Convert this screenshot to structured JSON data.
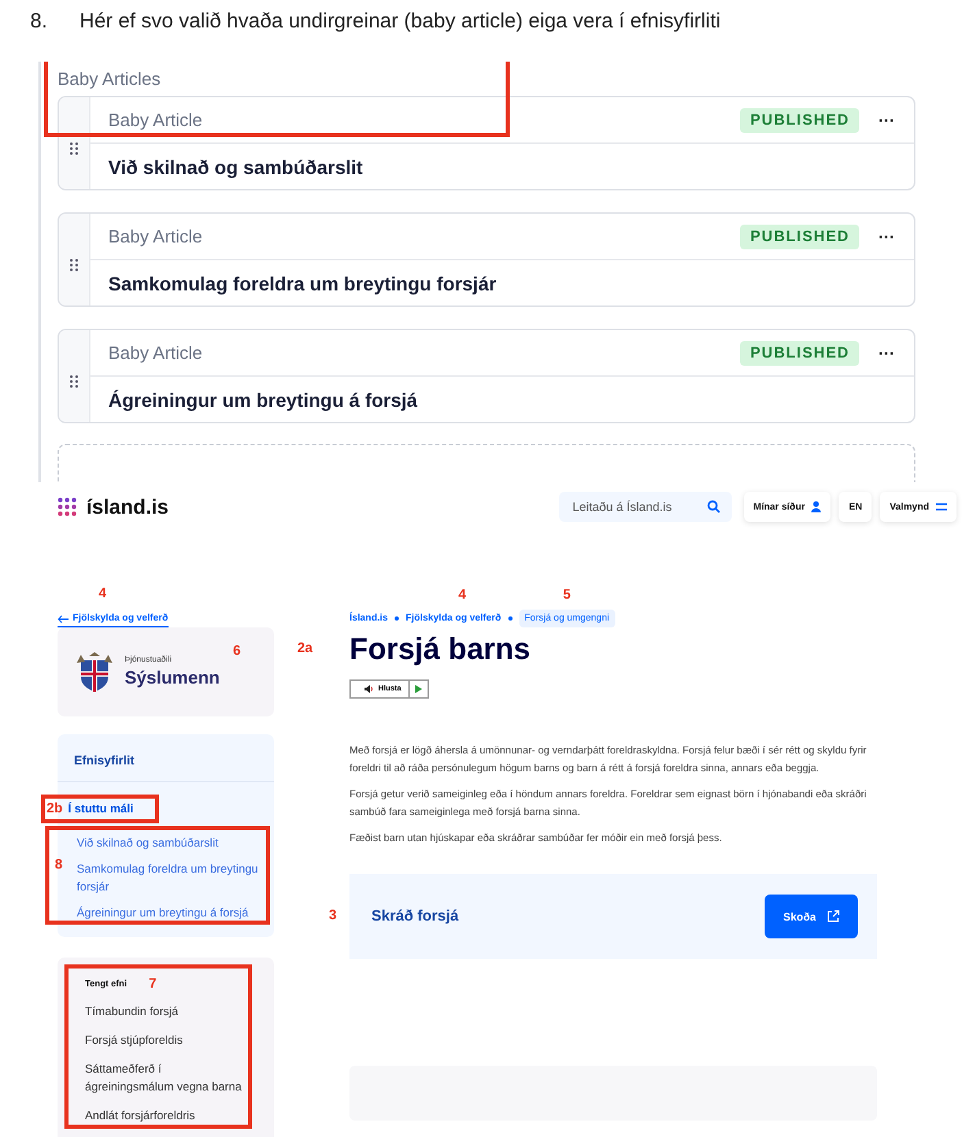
{
  "step": {
    "number": "8.",
    "text": "Hér ef svo valið hvaða undirgreinar (baby article) eiga vera í efnisyfirliti"
  },
  "cms": {
    "section_label": "Baby Articles",
    "annotation_box": true,
    "items": [
      {
        "type_label": "Baby Article",
        "status": "PUBLISHED",
        "menu": "···",
        "title": "Við skilnað og sambúðarslit"
      },
      {
        "type_label": "Baby Article",
        "status": "PUBLISHED",
        "menu": "···",
        "title": "Samkomulag foreldra um breytingu forsjár"
      },
      {
        "type_label": "Baby Article",
        "status": "PUBLISHED",
        "menu": "···",
        "title": "Ágreiningur um breytingu á forsjá"
      }
    ]
  },
  "site": {
    "logo": "ísland.is",
    "search": {
      "placeholder": "Leitaðu á Ísland.is"
    },
    "header_buttons": [
      {
        "kind": "user",
        "label": "Mínar síður"
      },
      {
        "kind": "plain",
        "label": "EN"
      },
      {
        "kind": "menu",
        "label": "Valmynd"
      }
    ],
    "back_link": {
      "label": "Fjölskylda og velferð",
      "annotation": "4"
    },
    "breadcrumbs": [
      {
        "label": "Ísland.is",
        "selected": false
      },
      {
        "label": "Fjölskylda og velferð",
        "selected": false,
        "annotation": "4"
      },
      {
        "label": "Forsjá og umgengni",
        "selected": true,
        "annotation": "5"
      }
    ],
    "organization": {
      "caption": "Þjónustuaðili",
      "name": "Sýslumenn",
      "annotation": "6"
    },
    "toc": {
      "title": "Efnisyfirlit",
      "current": {
        "label": "Í stuttu máli",
        "selected": true,
        "annotation": "2b"
      },
      "annotation": "8",
      "items": [
        {
          "label": "Við skilnað og sambúðarslit",
          "selected": false
        },
        {
          "label": "Samkomulag foreldra um breytingu forsjár",
          "selected": false
        },
        {
          "label": "Ágreiningur um breytingu á forsjá",
          "selected": false
        }
      ]
    },
    "related": {
      "title": "Tengt efni",
      "annotation": "7",
      "items": [
        "Tímabundin forsjá",
        "Forsjá stjúpforeldis",
        "Sáttameðferð í ágreiningsmálum vegna barna",
        "Andlát forsjárforeldris"
      ]
    },
    "article": {
      "title": "Forsjá barns",
      "annotation": "2a",
      "listen_button": "Hlusta",
      "paragraphs": [
        "Með forsjá er lögð áhersla á umönnunar- og verndarþátt foreldraskyldna. Forsjá felur bæði í sér rétt og skyldu fyrir foreldri til að ráða persónulegum högum barns og barn á rétt á forsjá foreldra sinna, annars eða beggja.",
        "Forsjá getur verið sameiginleg eða í höndum annars foreldra. Foreldrar sem eignast börn í hjónabandi eða skráðri sambúð fara sameiginlega með forsjá barna sinna.",
        "Fæðist barn utan hjúskapar eða skráðrar sambúðar fer móðir ein með forsjá þess."
      ],
      "cta": {
        "title": "Skráð forsjá",
        "button": "Skoða",
        "annotation": "3"
      }
    }
  }
}
